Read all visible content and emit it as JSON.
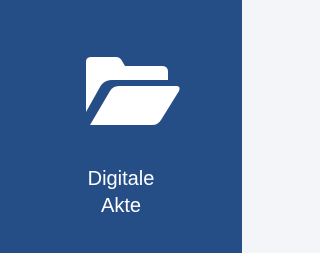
{
  "tile": {
    "icon": "folder-open-icon",
    "label_line1": "Digitale",
    "label_line2": "Akte",
    "background_color": "#254d86",
    "text_color": "#ffffff"
  }
}
